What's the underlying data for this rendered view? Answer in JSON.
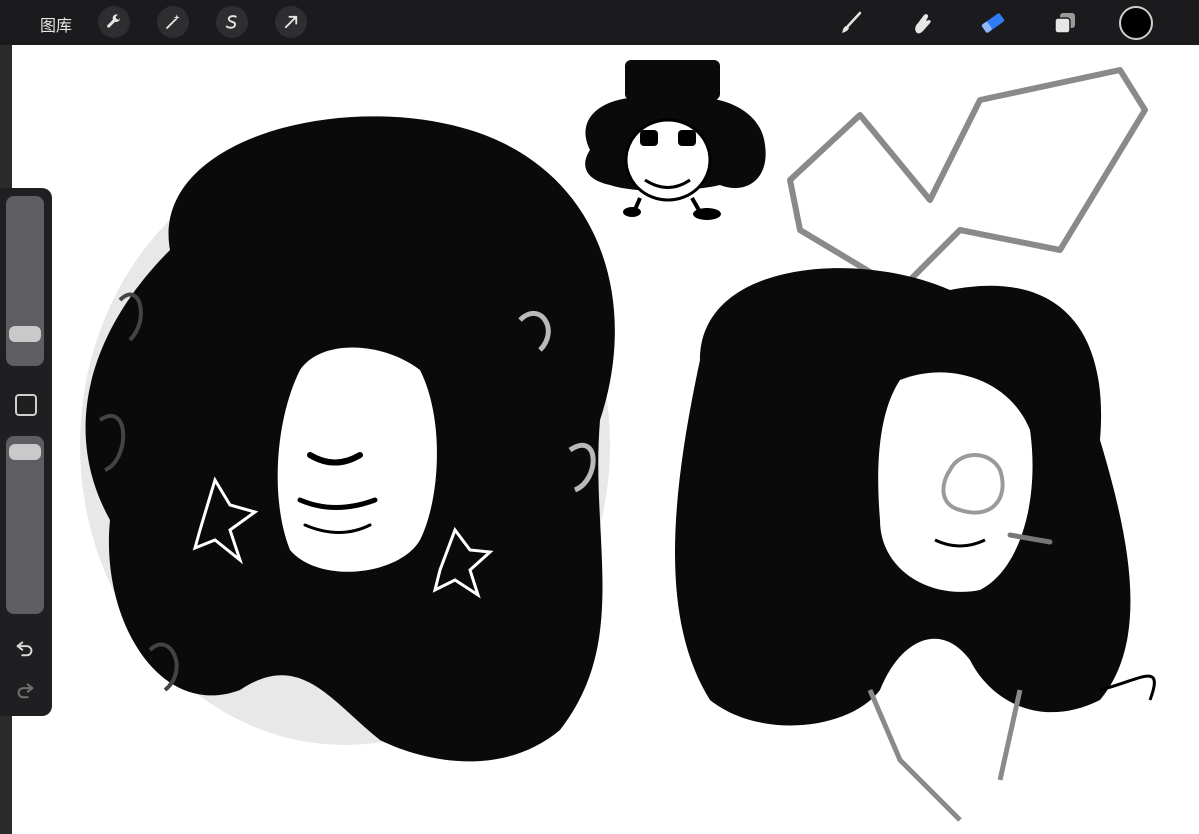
{
  "toolbar": {
    "gallery_label": "图库",
    "left_tools": [
      "wrench-icon",
      "magic-wand-icon",
      "selection-icon",
      "transform-arrow-icon"
    ],
    "right_tools": [
      "brush-icon",
      "smudge-icon",
      "eraser-icon",
      "layers-icon"
    ],
    "active_tool": "eraser-icon",
    "active_color": "#000000",
    "accent": "#2f7cf6"
  },
  "sidebar": {
    "controls": [
      "brush-size-slider",
      "modifier-button",
      "opacity-slider",
      "undo-icon",
      "redo-icon"
    ]
  }
}
